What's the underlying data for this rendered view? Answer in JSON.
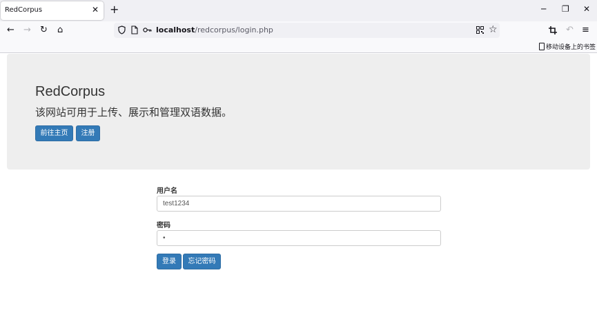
{
  "browser": {
    "tab": {
      "title": "RedCorpus",
      "close": "✕"
    },
    "new_tab": "+",
    "window_controls": {
      "minimize": "─",
      "restore": "❐",
      "close": "✕"
    },
    "nav": {
      "back": "←",
      "forward": "→",
      "reload": "↻",
      "home": "⌂"
    },
    "url": {
      "host": "localhost",
      "path": "/redcorpus/login.php"
    },
    "bookmarks_bar": {
      "mobile_bookmarks": "移动设备上的书签"
    }
  },
  "page": {
    "header": {
      "title": "RedCorpus",
      "description": "该网站可用于上传、展示和管理双语数据。",
      "home_button": "前往主页",
      "register_button": "注册"
    },
    "login_form": {
      "username_label": "用户名",
      "username_value": "test1234",
      "password_label": "密码",
      "password_value": "•",
      "login_button": "登录",
      "forgot_button": "忘记密码"
    }
  },
  "colors": {
    "primary_button": "#337ab7",
    "jumbotron_bg": "#eeeeee"
  }
}
